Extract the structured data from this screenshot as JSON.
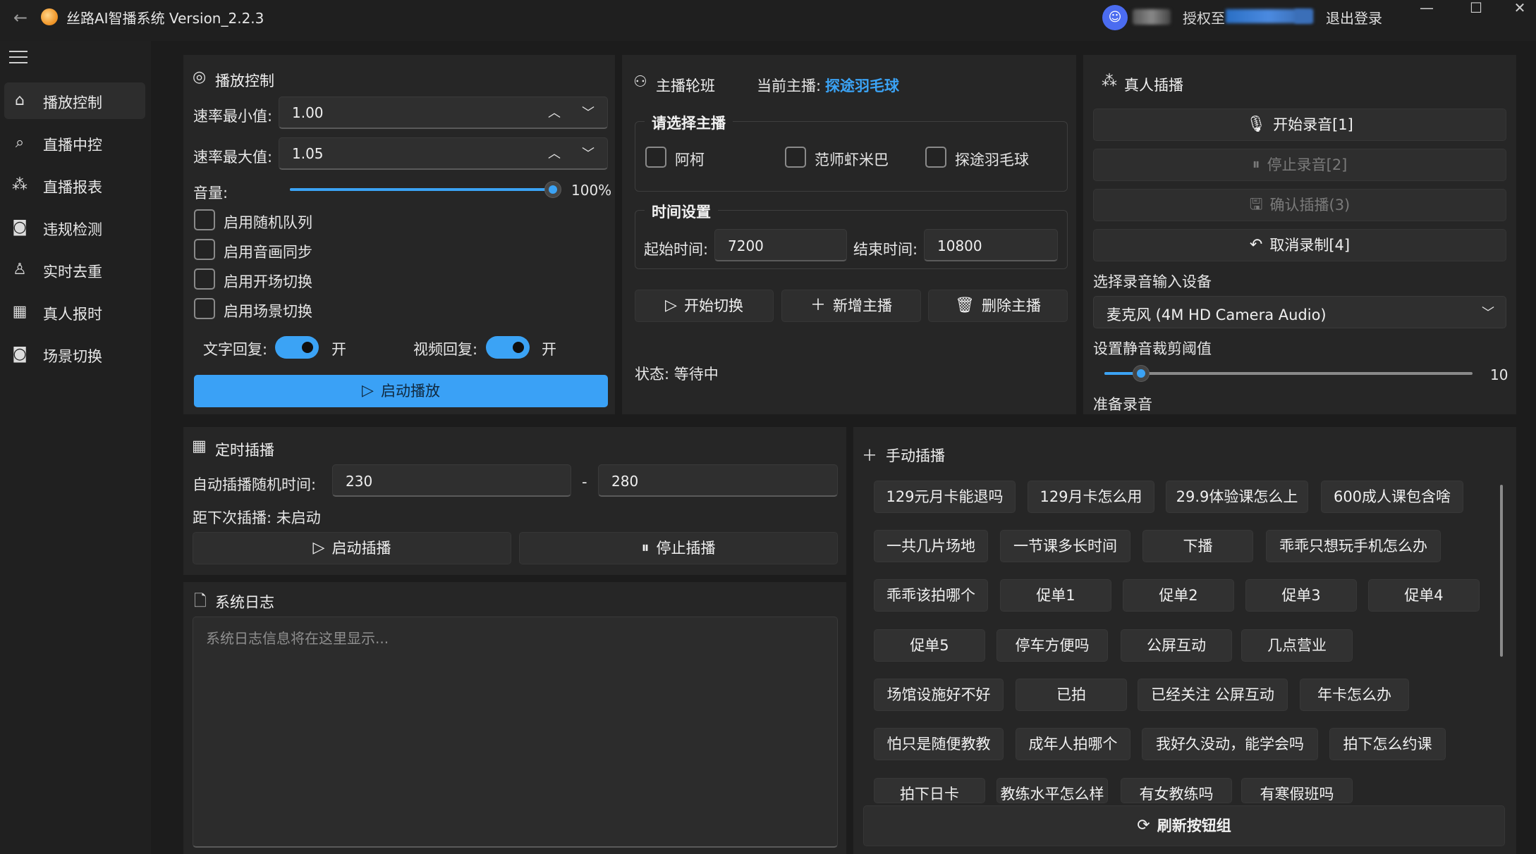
{
  "app": {
    "title": "丝路AI智播系统 Version_2.2.3",
    "auth_label": "授权至",
    "logout": "退出登录"
  },
  "sidebar": {
    "items": [
      {
        "label": "播放控制",
        "icon": "home-icon"
      },
      {
        "label": "直播中控",
        "icon": "search-chat-icon"
      },
      {
        "label": "直播报表",
        "icon": "network-icon"
      },
      {
        "label": "违规检测",
        "icon": "camera-icon"
      },
      {
        "label": "实时去重",
        "icon": "person-icon"
      },
      {
        "label": "真人报时",
        "icon": "calendar-icon"
      },
      {
        "label": "场景切换",
        "icon": "camera-icon"
      }
    ]
  },
  "playback": {
    "title": "播放控制",
    "rate_min_label": "速率最小值:",
    "rate_min_value": "1.00",
    "rate_max_label": "速率最大值:",
    "rate_max_value": "1.05",
    "volume_label": "音量:",
    "volume_text": "100%",
    "volume_level": 1.0,
    "checkboxes": [
      "启用随机队列",
      "启用音画同步",
      "启用开场切换",
      "启用场景切换"
    ],
    "text_reply_label": "文字回复:",
    "text_reply_state": "开",
    "video_reply_label": "视频回复:",
    "video_reply_state": "开",
    "start_button": "启动播放"
  },
  "rotation": {
    "title": "主播轮班",
    "current_label": "当前主播:",
    "current_name": "探途羽毛球",
    "select_title": "请选择主播",
    "anchors": [
      "阿柯",
      "范师虾米巴",
      "探途羽毛球"
    ],
    "time_title": "时间设置",
    "start_label": "起始时间:",
    "start_value": "7200",
    "end_label": "结束时间:",
    "end_value": "10800",
    "buttons": [
      "开始切换",
      "新增主播",
      "删除主播"
    ],
    "status": "状态: 等待中"
  },
  "live_insert": {
    "title": "真人插播",
    "buttons": [
      "开始录音[1]",
      "停止录音[2]",
      "确认插播(3)",
      "取消录制[4]"
    ],
    "device_label": "选择录音输入设备",
    "device_value": "麦克风 (4M HD Camera Audio)",
    "threshold_label": "设置静音裁剪阈值",
    "threshold_value": "10",
    "threshold_level": 0.1,
    "status": "准备录音"
  },
  "timed_insert": {
    "title": "定时插播",
    "random_label": "自动插播随机时间:",
    "min_value": "230",
    "dash": "-",
    "max_value": "280",
    "next_label": "距下次插播: 未启动",
    "start_button": "启动插播",
    "stop_button": "停止插播"
  },
  "syslog": {
    "title": "系统日志",
    "placeholder": "系统日志信息将在这里显示..."
  },
  "manual_insert": {
    "title": "手动插播",
    "rows": [
      [
        "129元月卡能退吗",
        "129月卡怎么用",
        "29.9体验课怎么上",
        "600成人课包含啥"
      ],
      [
        "一共几片场地",
        "一节课多长时间",
        "下播",
        "乖乖只想玩手机怎么办"
      ],
      [
        "乖乖该拍哪个",
        "促单1",
        "促单2",
        "促单3",
        "促单4"
      ],
      [
        "促单5",
        "停车方便吗",
        "公屏互动",
        "几点营业"
      ],
      [
        "场馆设施好不好",
        "已拍",
        "已经关注 公屏互动",
        "年卡怎么办"
      ],
      [
        "怕只是随便教教",
        "成年人拍哪个",
        "我好久没动，能学会吗",
        "拍下怎么约课"
      ],
      [
        "拍下日卡",
        "教练水平怎么样",
        "有女教练吗",
        "有寒假班吗"
      ]
    ],
    "refresh_button": "刷新按钮组"
  }
}
